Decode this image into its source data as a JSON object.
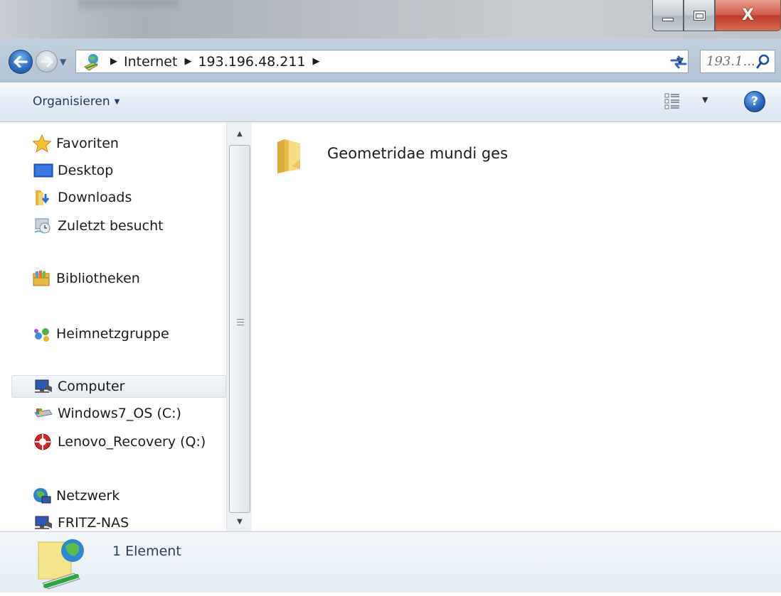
{
  "titlebar": {
    "buttons": [
      "minimize",
      "maximize",
      "close"
    ],
    "close_glyph": "X"
  },
  "navigation": {
    "back_icon": "back-arrow-icon",
    "forward_icon": "forward-arrow-icon",
    "breadcrumbs": [
      "Internet",
      "193.196.48.211"
    ],
    "search": {
      "value": "193.1..."
    }
  },
  "commandbar": {
    "organize_label": "Organisieren",
    "help_glyph": "?"
  },
  "sidebar": {
    "favorites_header": "Favoriten",
    "favorites": [
      "Desktop",
      "Downloads",
      "Zuletzt besucht"
    ],
    "libraries": "Bibliotheken",
    "homegroup": "Heimnetzgruppe",
    "computer_header": "Computer",
    "drives": [
      "Windows7_OS (C:)",
      "Lenovo_Recovery (Q:)"
    ],
    "network_header": "Netzwerk",
    "network_items": [
      "FRITZ-NAS"
    ]
  },
  "content": {
    "items": [
      {
        "name": "Geometridae mundi ges",
        "type": "folder"
      }
    ]
  },
  "status": {
    "item_count_text": "1 Element"
  },
  "colors": {
    "folder_yellow": "#f1cf63",
    "nav_blue": "#2f6fc0",
    "close_red": "#c7422f"
  }
}
